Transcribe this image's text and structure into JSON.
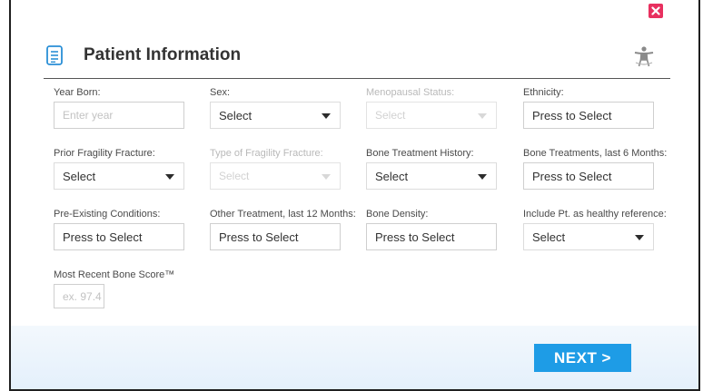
{
  "window": {
    "close_icon": "close-icon",
    "close_color": "#e8305f"
  },
  "header": {
    "title": "Patient Information",
    "title_icon": "document-list-icon",
    "figure_icon": "human-figure-icon"
  },
  "fields": {
    "year_born": {
      "label": "Year Born:",
      "placeholder": "Enter year"
    },
    "sex": {
      "label": "Sex:",
      "value": "Select"
    },
    "menopausal_status": {
      "label": "Menopausal Status:",
      "value": "Select"
    },
    "ethnicity": {
      "label": "Ethnicity:",
      "value": "Press to Select"
    },
    "prior_fragility_fracture": {
      "label": "Prior Fragility Fracture:",
      "value": "Select"
    },
    "type_of_fragility_fracture": {
      "label": "Type of Fragility Fracture:",
      "value": "Select"
    },
    "bone_treatment_history": {
      "label": "Bone Treatment History:",
      "value": "Select"
    },
    "bone_treatments_6m": {
      "label": "Bone Treatments, last 6 Months:",
      "value": "Press to Select"
    },
    "pre_existing_conditions": {
      "label": "Pre-Existing Conditions:",
      "value": "Press to Select"
    },
    "other_treatment_12m": {
      "label": "Other Treatment, last 12 Months:",
      "value": "Press to Select"
    },
    "bone_density": {
      "label": "Bone Density:",
      "value": "Press to Select"
    },
    "healthy_reference": {
      "label": "Include Pt. as healthy reference:",
      "value": "Select"
    },
    "bone_score": {
      "label": "Most Recent Bone Score™",
      "placeholder": "ex. 97.4"
    }
  },
  "footer": {
    "next_label": "NEXT >",
    "next_color": "#1e9ce6"
  }
}
